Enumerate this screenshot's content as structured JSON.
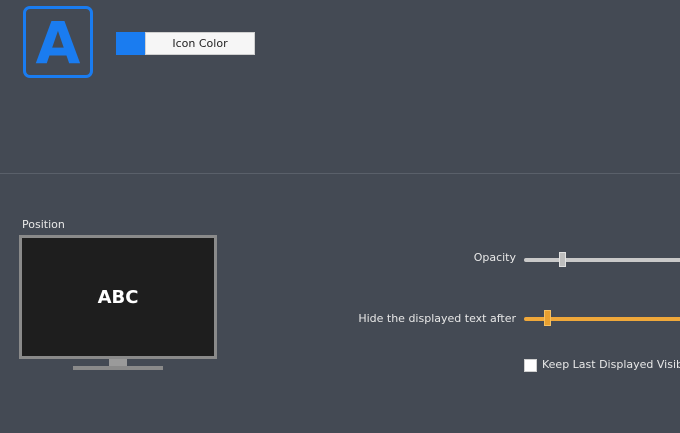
{
  "app_icon": {
    "letter": "A",
    "color": "#1a7cf0"
  },
  "icon_color": {
    "swatch_color": "#1a7cf0",
    "button_label": "Icon Color"
  },
  "position": {
    "label": "Position",
    "preview_text": "ABC"
  },
  "opacity": {
    "label": "Opacity",
    "value_fraction": 0.25
  },
  "hide_after": {
    "label": "Hide the displayed text after",
    "value_fraction": 0.13,
    "accent": "#f0a83a"
  },
  "keep_last": {
    "label": "Keep Last Displayed Visible",
    "checked": false
  }
}
